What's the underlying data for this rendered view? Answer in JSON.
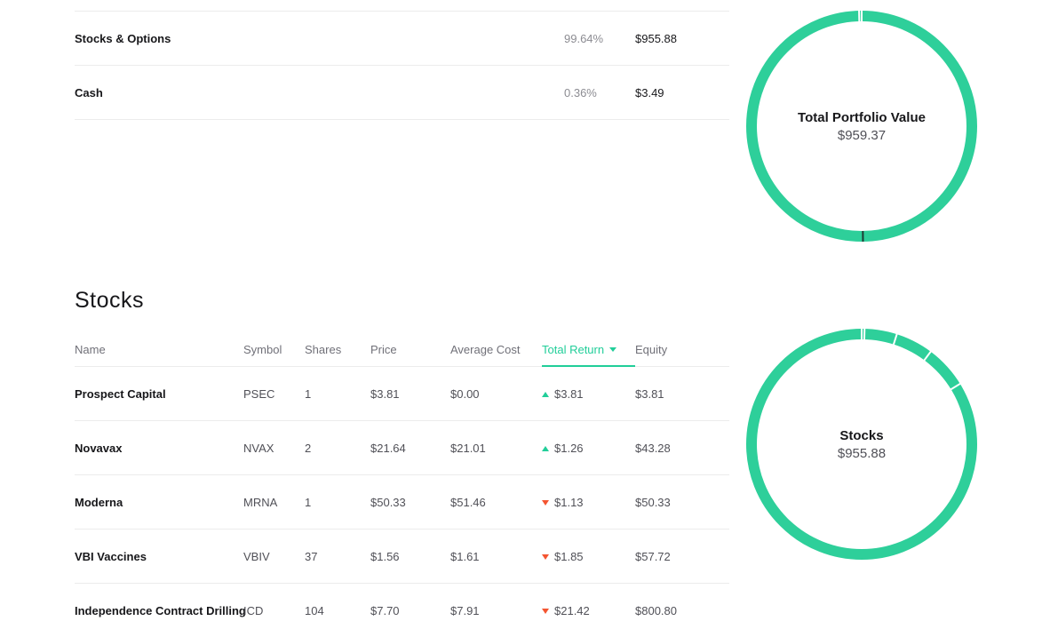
{
  "summary": {
    "rows": [
      {
        "name": "Stocks & Options",
        "percent": "99.64%",
        "value": "$955.88"
      },
      {
        "name": "Cash",
        "percent": "0.36%",
        "value": "$3.49"
      }
    ]
  },
  "portfolio_donut": {
    "title": "Total Portfolio Value",
    "value": "$959.37",
    "color": "#2ecf9a",
    "segments": [
      0.9964,
      0.0036
    ]
  },
  "stocks_section": {
    "title": "Stocks",
    "columns": {
      "name": "Name",
      "symbol": "Symbol",
      "shares": "Shares",
      "price": "Price",
      "avg_cost": "Average Cost",
      "total_return": "Total Return",
      "equity": "Equity"
    },
    "sort_column": "total_return",
    "rows": [
      {
        "name": "Prospect Capital",
        "symbol": "PSEC",
        "shares": "1",
        "price": "$3.81",
        "avg_cost": "$0.00",
        "direction": "up",
        "total_return": "$3.81",
        "equity": "$3.81"
      },
      {
        "name": "Novavax",
        "symbol": "NVAX",
        "shares": "2",
        "price": "$21.64",
        "avg_cost": "$21.01",
        "direction": "up",
        "total_return": "$1.26",
        "equity": "$43.28"
      },
      {
        "name": "Moderna",
        "symbol": "MRNA",
        "shares": "1",
        "price": "$50.33",
        "avg_cost": "$51.46",
        "direction": "down",
        "total_return": "$1.13",
        "equity": "$50.33"
      },
      {
        "name": "VBI Vaccines",
        "symbol": "VBIV",
        "shares": "37",
        "price": "$1.56",
        "avg_cost": "$1.61",
        "direction": "down",
        "total_return": "$1.85",
        "equity": "$57.72"
      },
      {
        "name": "Independence Contract Drilling",
        "symbol": "ICD",
        "shares": "104",
        "price": "$7.70",
        "avg_cost": "$7.91",
        "direction": "down",
        "total_return": "$21.42",
        "equity": "$800.80"
      }
    ]
  },
  "stocks_donut": {
    "title": "Stocks",
    "value": "$955.88",
    "color": "#2ecf9a",
    "segments": [
      0.004,
      0.0453,
      0.0527,
      0.0604,
      0.8378
    ]
  },
  "colors": {
    "accent": "#21ce99",
    "negative": "#f45531",
    "text": "#17171a",
    "muted": "#8c8c92"
  }
}
